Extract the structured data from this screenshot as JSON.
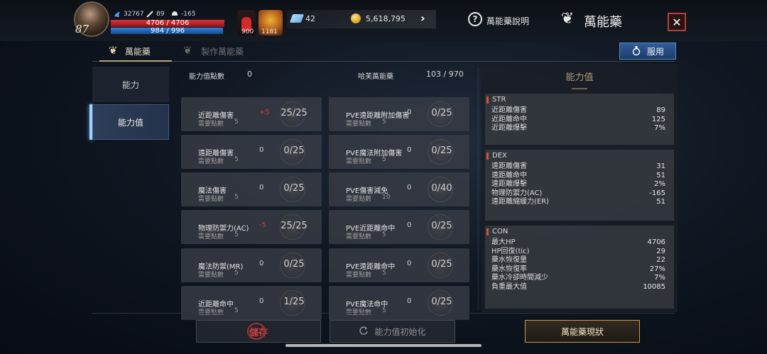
{
  "header": {
    "level": "87",
    "stats": {
      "combat_power": "32767",
      "attack": "89",
      "defense": "-165"
    },
    "hp": "4706 / 4706",
    "mp": "984 / 996",
    "hp_fraction": 1.0,
    "mp_fraction": 0.988,
    "potion_count": "900",
    "buff_count": "1181",
    "gems": "42",
    "gold": "5,618,795",
    "help_label": "萬能藥說明",
    "title": "萬能藥"
  },
  "tabs": [
    {
      "label": "萬能藥",
      "active": true
    },
    {
      "label": "製作萬能藥",
      "active": false
    }
  ],
  "use_button": "服用",
  "sidebar": [
    {
      "label": "能力",
      "active": false
    },
    {
      "label": "能力值",
      "active": true
    }
  ],
  "points": {
    "label": "能力值點數",
    "value": "0",
    "used_label": "哈芙萬能藥",
    "used_value": "103 / 970"
  },
  "cards_left": [
    {
      "name": "近距離傷害",
      "req_label": "需要點數",
      "req": "5",
      "bonus": "+5",
      "bonus_neg": true,
      "ratio": "25/25"
    },
    {
      "name": "遠距離傷害",
      "req_label": "需要點數",
      "req": "5",
      "bonus": "0",
      "bonus_neg": false,
      "ratio": "0/25"
    },
    {
      "name": "魔法傷害",
      "req_label": "需要點數",
      "req": "5",
      "bonus": "0",
      "bonus_neg": false,
      "ratio": "0/25"
    },
    {
      "name": "物理防禦力(AC)",
      "req_label": "需要點數",
      "req": "5",
      "bonus": "-5",
      "bonus_neg": true,
      "ratio": "25/25"
    },
    {
      "name": "魔法防禦(MR)",
      "req_label": "需要點數",
      "req": "5",
      "bonus": "0",
      "bonus_neg": false,
      "ratio": "0/25"
    },
    {
      "name": "近距離命中",
      "req_label": "需要點數",
      "req": "5",
      "bonus": "0",
      "bonus_neg": false,
      "ratio": "1/25"
    }
  ],
  "cards_right": [
    {
      "name": "PVE遠距離附加傷害",
      "req_label": "需要點數",
      "req": "5",
      "bonus": "0",
      "ratio": "0/25"
    },
    {
      "name": "PVE魔法附加傷害",
      "req_label": "需要點數",
      "req": "5",
      "bonus": "0",
      "ratio": "0/25"
    },
    {
      "name": "PVE傷害減免",
      "req_label": "需要點數",
      "req": "10",
      "bonus": "0",
      "ratio": "0/40"
    },
    {
      "name": "PVE近距離命中",
      "req_label": "需要點數",
      "req": "5",
      "bonus": "0",
      "ratio": "0/25"
    },
    {
      "name": "PVE遠距離命中",
      "req_label": "需要點數",
      "req": "5",
      "bonus": "0",
      "ratio": "0/25"
    },
    {
      "name": "PVE魔法命中",
      "req_label": "需要點數",
      "req": "5",
      "bonus": "0",
      "ratio": "0/25"
    }
  ],
  "stat_panel": {
    "title": "能力值",
    "str": {
      "head": "STR",
      "rows": [
        {
          "k": "近距離傷害",
          "v": "89"
        },
        {
          "k": "近距離命中",
          "v": "125"
        },
        {
          "k": "近距離爆擊",
          "v": "7%"
        }
      ]
    },
    "dex": {
      "head": "DEX",
      "rows": [
        {
          "k": "遠距離傷害",
          "v": "31"
        },
        {
          "k": "遠距離命中",
          "v": "51"
        },
        {
          "k": "遠距離爆擊",
          "v": "2%"
        },
        {
          "k": "物理防禦力(AC)",
          "v": "-165"
        },
        {
          "k": "遠距離縮緩力(ER)",
          "v": "51"
        }
      ]
    },
    "con": {
      "head": "CON",
      "rows": [
        {
          "k": "最大HP",
          "v": "4706"
        },
        {
          "k": "HP回復(tic)",
          "v": "29"
        },
        {
          "k": "藥水恢復量",
          "v": "22"
        },
        {
          "k": "藥水恢復率",
          "v": "27%"
        },
        {
          "k": "藥水冷卻時間減少",
          "v": "7%"
        },
        {
          "k": "負重最大值",
          "v": "10085"
        }
      ]
    }
  },
  "bottom": {
    "save": "儲存",
    "reset": "能力值初始化",
    "status": "萬能藥現狀"
  }
}
